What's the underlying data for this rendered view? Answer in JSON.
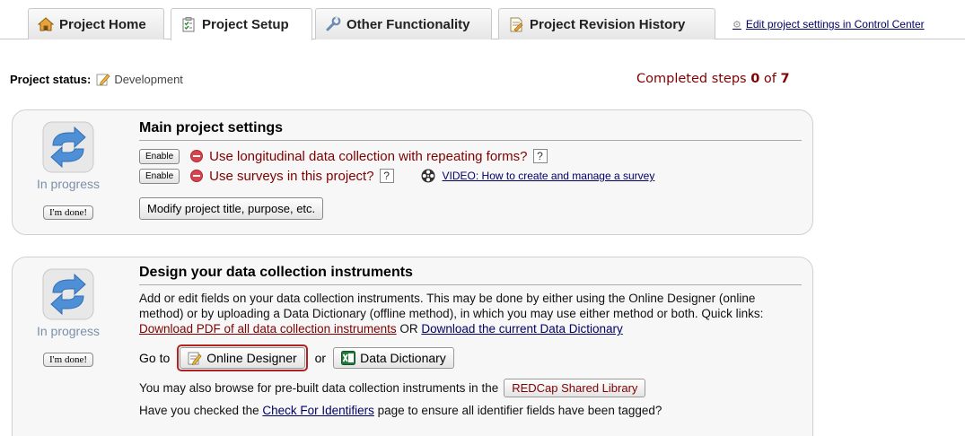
{
  "tabs": [
    {
      "label": "Project Home",
      "icon": "home-icon",
      "active": false
    },
    {
      "label": "Project Setup",
      "icon": "checklist-icon",
      "active": true
    },
    {
      "label": "Other Functionality",
      "icon": "wrench-icon",
      "active": false
    },
    {
      "label": "Project Revision History",
      "icon": "document-icon",
      "active": false
    }
  ],
  "control_center_link": "Edit project settings in Control Center",
  "status": {
    "label": "Project status:",
    "value": "Development",
    "steps_prefix": "Completed steps ",
    "steps_done": "0",
    "steps_of": " of ",
    "steps_total": "7"
  },
  "panel1": {
    "progress_label": "In progress",
    "done_button": "I'm done!",
    "heading": "Main project settings",
    "enable_label": "Enable",
    "longitudinal_text": "Use longitudinal data collection with repeating forms?",
    "surveys_text": "Use surveys in this project?",
    "help_label": "?",
    "video_link": "VIDEO: How to create and manage a survey",
    "modify_button": "Modify project title, purpose, etc."
  },
  "panel2": {
    "progress_label": "In progress",
    "done_button": "I'm done!",
    "heading": "Design your data collection instruments",
    "description": "Add or edit fields on your data collection instruments. This may be done by either using the Online Designer (online method) or by uploading a Data Dictionary (offline method), in which you may use either method or both. Quick links: ",
    "pdf_link": "Download PDF of all data collection instruments",
    "or_text": " OR ",
    "dictionary_link": "Download the current Data Dictionary",
    "goto_text": "Go to",
    "online_designer": "Online Designer",
    "or_short": "or",
    "data_dictionary": "Data Dictionary",
    "library_text": "You may also browse for pre-built data collection instruments in the",
    "library_button": "REDCap Shared Library",
    "identifiers_prefix": "Have you checked the ",
    "identifiers_link": "Check For Identifiers",
    "identifiers_suffix": " page to ensure all identifier fields have been tagged?"
  },
  "colors": {
    "accent_maroon": "#800000",
    "link_blue": "#000066",
    "panel_bg": "#f7f7f7",
    "progress_text": "#7a90aa",
    "highlight_border": "#b22222"
  }
}
